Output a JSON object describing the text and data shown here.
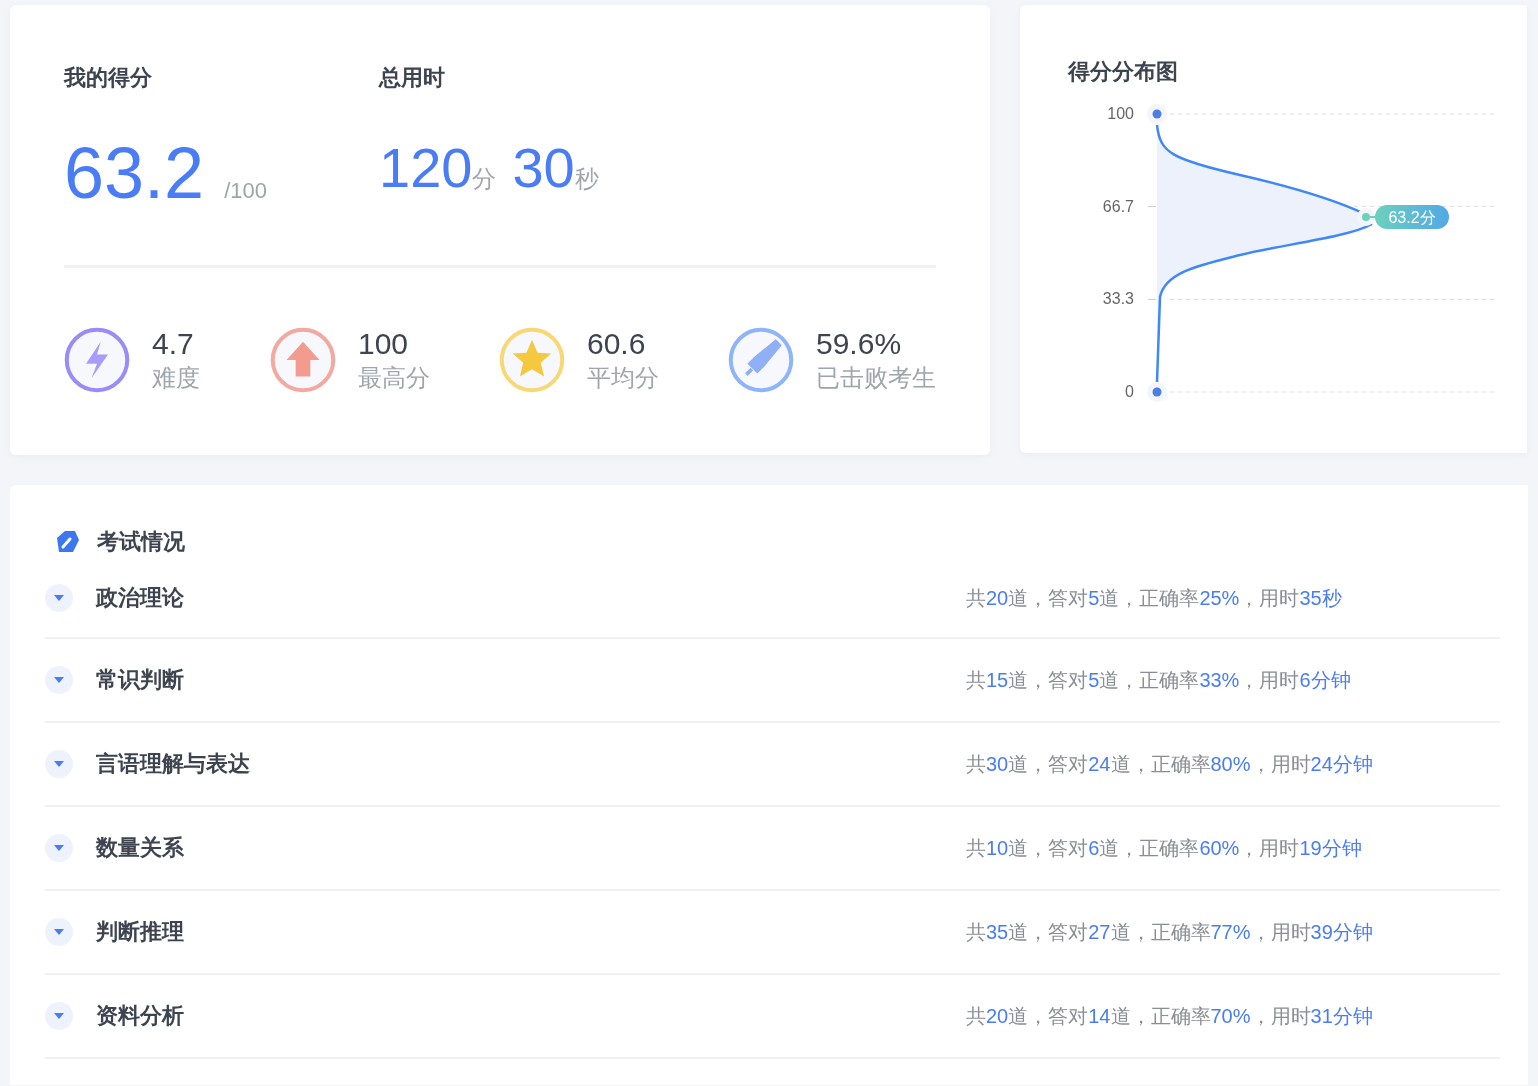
{
  "score_panel": {
    "score_label": "我的得分",
    "score": "63.2",
    "score_max": "/100",
    "time_label": "总用时",
    "time_parts": [
      {
        "value": "120",
        "unit": "分"
      },
      {
        "value": "30",
        "unit": "秒"
      }
    ],
    "stats": [
      {
        "kind": "lightning",
        "color": "#9a8cf6",
        "value": "4.7",
        "label": "难度"
      },
      {
        "kind": "arrow",
        "color": "#f2a9a0",
        "value": "100",
        "label": "最高分"
      },
      {
        "kind": "star",
        "color": "#f8d874",
        "value": "60.6",
        "label": "平均分"
      },
      {
        "kind": "sword",
        "color": "#8fb4f8",
        "value": "59.6%",
        "label": "已击败考生"
      }
    ]
  },
  "distribution": {
    "title": "得分分布图",
    "y_axis_labels": [
      "100",
      "66.7",
      "33.3",
      "0"
    ],
    "marker_label": "63.2分"
  },
  "exam": {
    "title": "考试情况",
    "sections": [
      {
        "name": "政治理论",
        "expanded": false,
        "summary": "共**20**道，答对**5**道，正确率**25%**，用时**35秒**"
      },
      {
        "name": "常识判断",
        "expanded": false,
        "summary": "共**15**道，答对**5**道，正确率**33%**，用时**6分钟**"
      },
      {
        "name": "言语理解与表达",
        "expanded": false,
        "summary": "共**30**道，答对**24**道，正确率**80%**，用时**24分钟**"
      },
      {
        "name": "数量关系",
        "expanded": false,
        "summary": "共**10**道，答对**6**道，正确率**60%**，用时**19分钟**"
      },
      {
        "name": "判断推理",
        "expanded": false,
        "summary": "共**35**道，答对**27**道，正确率**77%**，用时**39分钟**"
      },
      {
        "name": "资料分析",
        "expanded": false,
        "summary": "共**20**道，答对**14**道，正确率**70%**，用时**31分钟**"
      }
    ]
  }
}
